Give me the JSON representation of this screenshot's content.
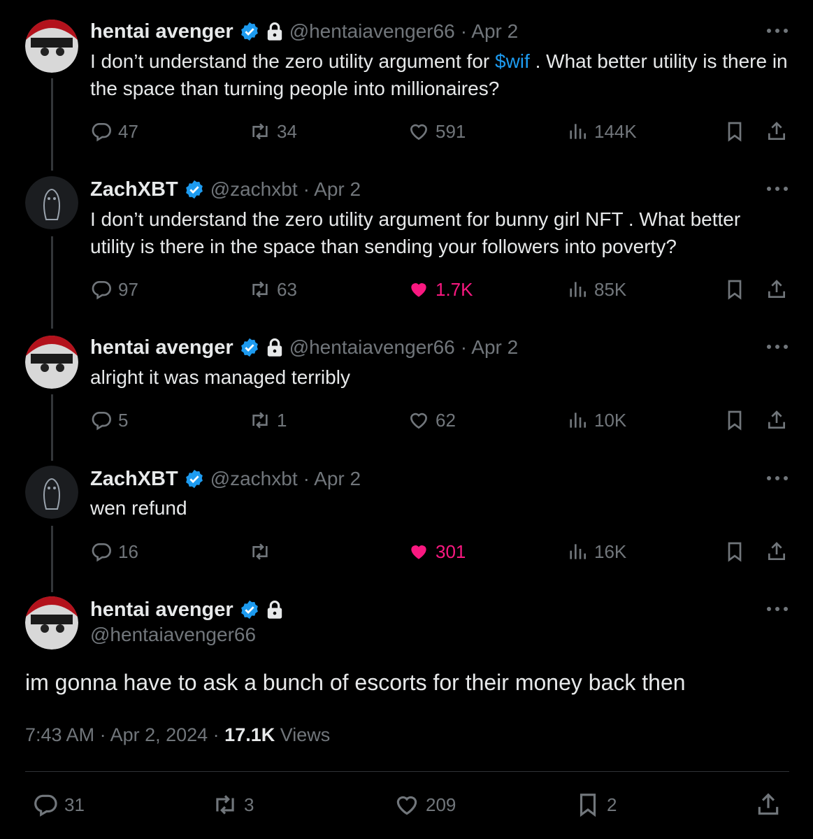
{
  "tweets": [
    {
      "name": "hentai avenger",
      "handle": "@hentaiavenger66",
      "date": "· Apr 2",
      "text_before": "I don’t understand the zero utility argument for ",
      "link": "$wif",
      "text_after": " . What better utility is there in the space than turning people into millionaires?",
      "replies": "47",
      "retweets": "34",
      "likes": "591",
      "views": "144K"
    },
    {
      "name": "ZachXBT",
      "handle": "@zachxbt",
      "date": "· Apr 2",
      "text": "I don’t understand the zero utility argument for bunny girl NFT . What better utility is there in the space than sending your followers into poverty?",
      "replies": "97",
      "retweets": "63",
      "likes": "1.7K",
      "views": "85K"
    },
    {
      "name": "hentai avenger",
      "handle": "@hentaiavenger66",
      "date": "· Apr 2",
      "text": "alright it was managed terribly",
      "replies": "5",
      "retweets": "1",
      "likes": "62",
      "views": "10K"
    },
    {
      "name": "ZachXBT",
      "handle": "@zachxbt",
      "date": "· Apr 2",
      "text": "wen refund",
      "replies": "16",
      "retweets": "",
      "likes": "301",
      "views": "16K"
    }
  ],
  "main": {
    "name": "hentai avenger",
    "handle": "@hentaiavenger66",
    "text": "im gonna have to ask a bunch of escorts for their money back then",
    "time": "7:43 AM · Apr 2, 2024 · ",
    "views_count": "17.1K",
    "views_label": " Views",
    "replies": "31",
    "retweets": "3",
    "likes": "209",
    "bookmarks": "2"
  },
  "colors": {
    "accent": "#1d9bf0",
    "like": "#f91880",
    "muted": "#71767b",
    "text": "#e7e9ea"
  }
}
